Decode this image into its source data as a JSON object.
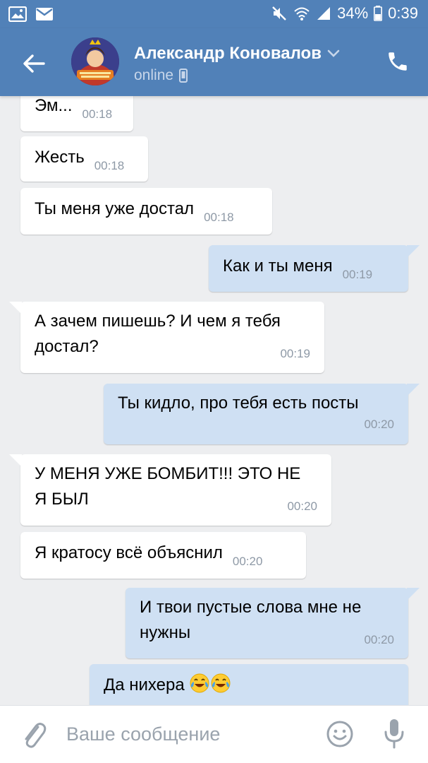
{
  "status_bar": {
    "battery": "34%",
    "time": "0:39"
  },
  "header": {
    "contact_name": "Александр Коновалов",
    "status": "online"
  },
  "messages": [
    {
      "direction": "in",
      "text": "Эм...",
      "time": "00:18"
    },
    {
      "direction": "in",
      "text": "Жесть",
      "time": "00:18"
    },
    {
      "direction": "in",
      "text": "Ты меня уже достал",
      "time": "00:18"
    },
    {
      "direction": "out",
      "text": "Как и ты меня",
      "time": "00:19"
    },
    {
      "direction": "in",
      "text": "А зачем пишешь? И чем я тебя\nдостал?",
      "time": "00:19"
    },
    {
      "direction": "out",
      "text": "Ты кидло, про тебя есть посты",
      "time": "00:20"
    },
    {
      "direction": "in",
      "text": "У МЕНЯ УЖЕ БОМБИТ!!! ЭТО НЕ\nЯ БЫЛ",
      "time": "00:20"
    },
    {
      "direction": "in",
      "text": "Я кратосу всё объяснил",
      "time": "00:20"
    },
    {
      "direction": "out",
      "text": "И твои пустые слова мне не\nнужны",
      "time": "00:20"
    },
    {
      "direction": "out",
      "text": "Да нихера",
      "emoji": [
        "face-with-tears-of-joy",
        "face-with-tears-of-joy"
      ]
    }
  ],
  "composer": {
    "placeholder": "Ваше сообщение"
  },
  "colors": {
    "header": "#5181b8",
    "background": "#edeef0",
    "incoming_bubble": "#ffffff",
    "outgoing_bubble": "#cfe0f3",
    "time_text": "#8e99a6"
  }
}
